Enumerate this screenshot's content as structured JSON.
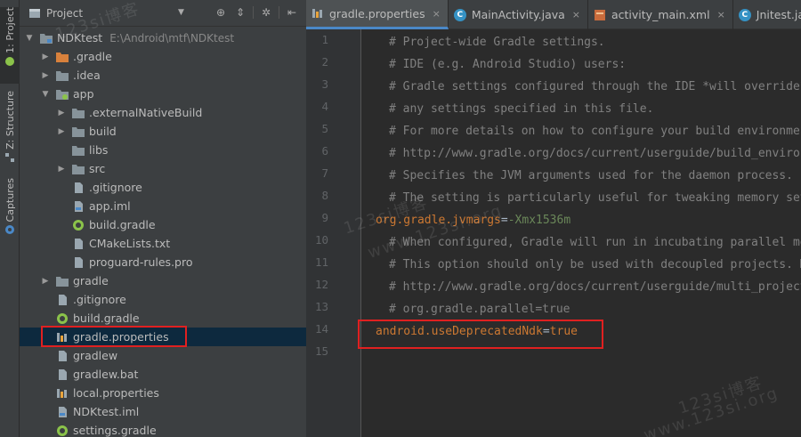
{
  "sidebar_strip": {
    "items": [
      {
        "label": "1: Project"
      },
      {
        "label": "Z: Structure"
      },
      {
        "label": "Captures"
      }
    ]
  },
  "project_panel": {
    "title": "Project",
    "tree": [
      {
        "label": "NDKtest",
        "path": "E:\\Android\\mtf\\NDKtest"
      },
      {
        "label": ".gradle"
      },
      {
        "label": ".idea"
      },
      {
        "label": "app"
      },
      {
        "label": ".externalNativeBuild"
      },
      {
        "label": "build"
      },
      {
        "label": "libs"
      },
      {
        "label": "src"
      },
      {
        "label": ".gitignore"
      },
      {
        "label": "app.iml"
      },
      {
        "label": "build.gradle"
      },
      {
        "label": "CMakeLists.txt"
      },
      {
        "label": "proguard-rules.pro"
      },
      {
        "label": "gradle"
      },
      {
        "label": ".gitignore"
      },
      {
        "label": "build.gradle"
      },
      {
        "label": "gradle.properties"
      },
      {
        "label": "gradlew"
      },
      {
        "label": "gradlew.bat"
      },
      {
        "label": "local.properties"
      },
      {
        "label": "NDKtest.iml"
      },
      {
        "label": "settings.gradle"
      }
    ]
  },
  "editor": {
    "tabs": [
      {
        "label": "gradle.properties",
        "close": "×"
      },
      {
        "label": "MainActivity.java",
        "close": "×"
      },
      {
        "label": "activity_main.xml",
        "close": "×"
      },
      {
        "label": "Jnitest.java",
        "close": "×"
      }
    ],
    "line_numbers": [
      "1",
      "2",
      "3",
      "4",
      "5",
      "6",
      "7",
      "8",
      "9",
      "10",
      "11",
      "12",
      "13",
      "14",
      "15"
    ],
    "lines": [
      {
        "text": "# Project-wide Gradle settings."
      },
      {
        "text": "# IDE (e.g. Android Studio) users:"
      },
      {
        "text": "# Gradle settings configured through the IDE *will override*"
      },
      {
        "text": "# any settings specified in this file."
      },
      {
        "text": "# For more details on how to configure your build environment"
      },
      {
        "text": "# http://www.gradle.org/docs/current/userguide/build_environment"
      },
      {
        "text": "# Specifies the JVM arguments used for the daemon process."
      },
      {
        "text": "# The setting is particularly useful for tweaking memory settings."
      },
      {
        "key": "org.gradle.jvmargs",
        "eq": "=",
        "value": "-Xmx1536m"
      },
      {
        "text": "# When configured, Gradle will run in incubating parallel mode."
      },
      {
        "text": "# This option should only be used with decoupled projects. More"
      },
      {
        "text": "# http://www.gradle.org/docs/current/userguide/multi_project"
      },
      {
        "text": "# org.gradle.parallel=true"
      },
      {
        "key": "android.useDeprecatedNdk",
        "eq": "=",
        "value": "true"
      },
      {
        "text": ""
      }
    ]
  },
  "watermarks": [
    "123si博客",
    "www.123si.org",
    "123si博客",
    "www.123si.org"
  ]
}
